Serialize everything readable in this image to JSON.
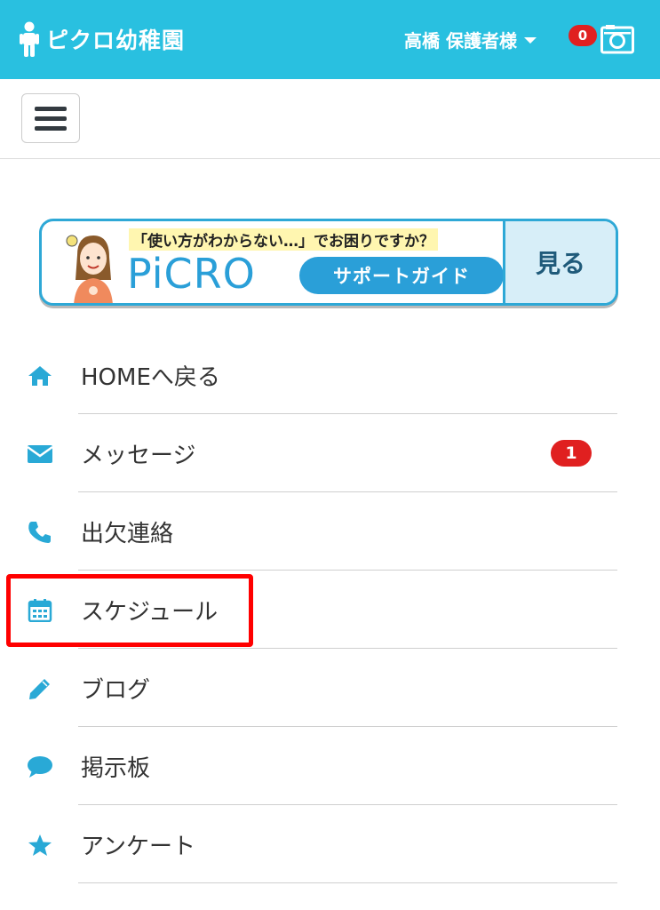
{
  "header": {
    "app_name": "ピクロ幼稚園",
    "user_label": "高橋 保護者様",
    "notification_count": "0"
  },
  "banner": {
    "question": "「使い方がわからない…」でお困りですか？",
    "logo": "PiCRO",
    "support_label": "サポートガイド",
    "look_label": "見る"
  },
  "menu": {
    "items": [
      {
        "label": "HOMEへ戻る",
        "icon": "home-icon"
      },
      {
        "label": "メッセージ",
        "icon": "envelope-icon",
        "badge": "1"
      },
      {
        "label": "出欠連絡",
        "icon": "phone-icon"
      },
      {
        "label": "スケジュール",
        "icon": "calendar-icon"
      },
      {
        "label": "ブログ",
        "icon": "pencil-icon"
      },
      {
        "label": "掲示板",
        "icon": "comment-icon"
      },
      {
        "label": "アンケート",
        "icon": "star-icon"
      }
    ]
  },
  "colors": {
    "header_bg": "#29c0e0",
    "accent": "#29a9d6",
    "badge_red": "#e02020",
    "highlight_red": "#ff0000"
  }
}
